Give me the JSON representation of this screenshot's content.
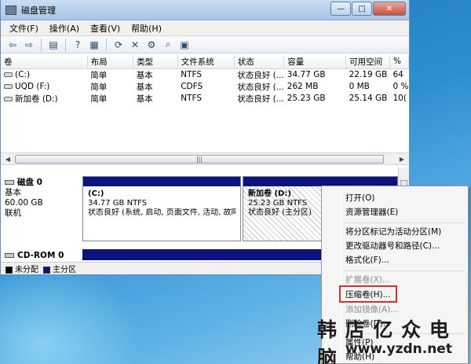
{
  "window": {
    "title": "磁盘管理",
    "controls": {
      "minimize": "—",
      "maximize": "□",
      "close": "✕"
    }
  },
  "menu": [
    "文件(F)",
    "操作(A)",
    "查看(V)",
    "帮助(H)"
  ],
  "toolbar": [
    "arrow-left-icon",
    "arrow-right-icon",
    "console-tree-icon",
    "help-icon",
    "properties-icon",
    "refresh-icon",
    "delete-icon",
    "settings-icon",
    "find-icon",
    "tile-icon"
  ],
  "volume_table": {
    "columns": [
      "卷",
      "布局",
      "类型",
      "文件系统",
      "状态",
      "容量",
      "可用空间",
      "%"
    ],
    "rows": [
      [
        "(C:)",
        "简单",
        "基本",
        "NTFS",
        "状态良好 (...",
        "34.77 GB",
        "22.19 GB",
        "64"
      ],
      [
        "UQD (F:)",
        "简单",
        "基本",
        "CDFS",
        "状态良好 (...",
        "262 MB",
        "0 MB",
        "0 %"
      ],
      [
        "新加卷 (D:)",
        "简单",
        "基本",
        "NTFS",
        "状态良好 (...",
        "25.23 GB",
        "25.14 GB",
        "10("
      ]
    ]
  },
  "disks": {
    "disk0": {
      "name": "磁盘 0",
      "type": "基本",
      "size": "60.00 GB",
      "status": "联机"
    },
    "cdrom0": {
      "name": "CD-ROM 0"
    },
    "partC": {
      "name": "(C:)",
      "size": "34.77 GB NTFS",
      "status": "状态良好 (系统, 启动, 页面文件, 活动, 故障"
    },
    "partD": {
      "name": "新加卷  (D:)",
      "size": "25.23 GB NTFS",
      "status": "状态良好 (主分区)"
    }
  },
  "legend": {
    "unallocated": "未分配",
    "primary": "主分区",
    "unallocated_color": "#000000",
    "primary_color": "#0b137f"
  },
  "context_menu": {
    "items": [
      {
        "label": "打开(O)",
        "enabled": true
      },
      {
        "label": "资源管理器(E)",
        "enabled": true
      },
      {
        "label": "将分区标记为活动分区(M)",
        "enabled": true
      },
      {
        "label": "更改驱动器号和路径(C)...",
        "enabled": true
      },
      {
        "label": "格式化(F)...",
        "enabled": true
      },
      {
        "label": "扩展卷(X)...",
        "enabled": false
      },
      {
        "label": "压缩卷(H)...",
        "enabled": true
      },
      {
        "label": "添加镜像(A)...",
        "enabled": false
      },
      {
        "label": "删除卷(D)...",
        "enabled": true
      },
      {
        "label": "属性(P)",
        "enabled": true
      },
      {
        "label": "帮助(H)",
        "enabled": true
      }
    ]
  },
  "watermark": {
    "line1": "韩 店 亿 众 电 脑",
    "line2": "www.yzdn.net"
  }
}
